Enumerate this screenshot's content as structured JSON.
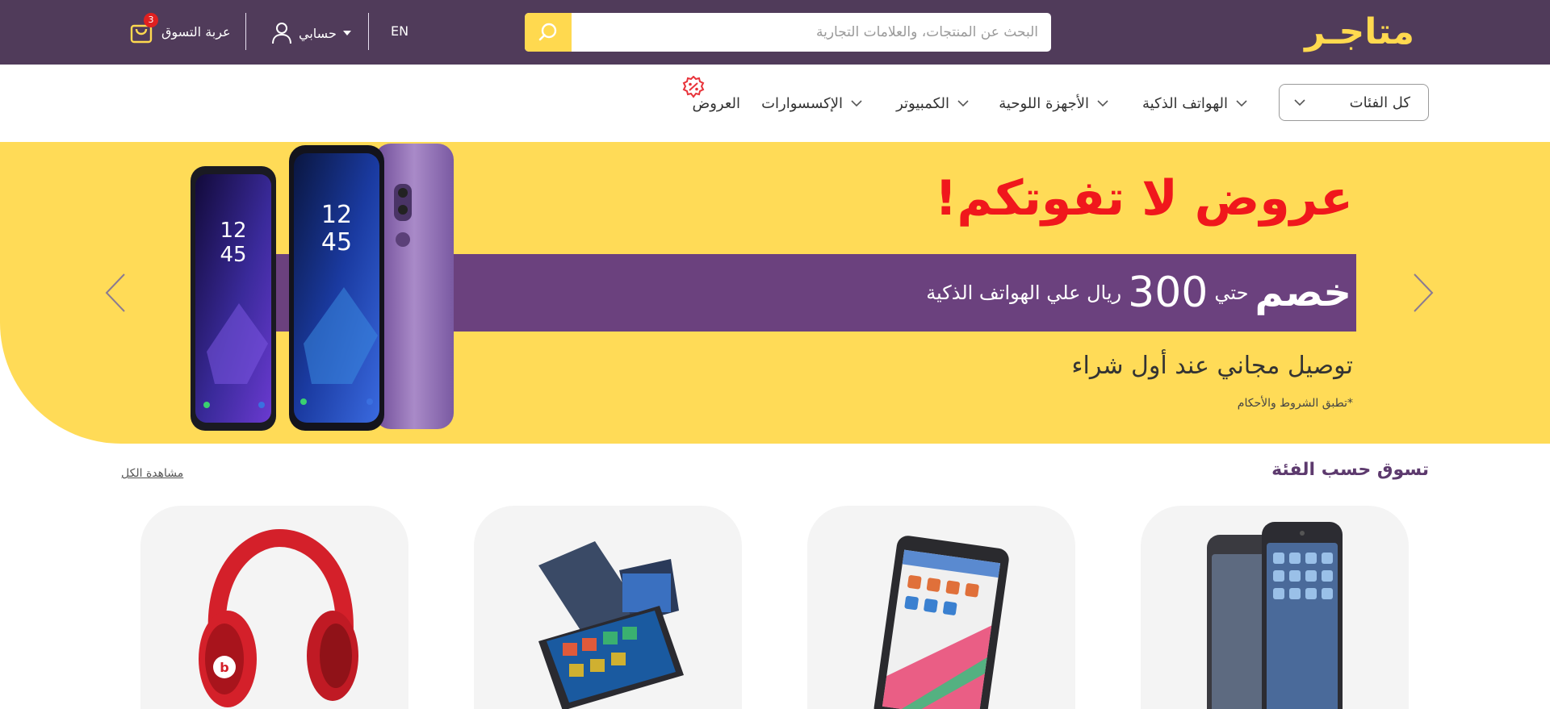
{
  "header": {
    "logo": "متاجـر",
    "search": {
      "placeholder": "البحث عن المنتجات، والعلامات التجارية"
    },
    "lang_label": "EN",
    "account_label": "حسابي",
    "cart_label": "عربة التسوق",
    "cart_count": "3",
    "colors": {
      "bar": "#503b5a",
      "accent": "#ffd94f",
      "badge": "#e02020"
    }
  },
  "nav": {
    "all_categories": "كل الفئات",
    "items": [
      {
        "label": "الهواتف الذكية",
        "has_dropdown": true
      },
      {
        "label": "الأجهزة اللوحية",
        "has_dropdown": true
      },
      {
        "label": "الكمبيوتر",
        "has_dropdown": true
      },
      {
        "label": "الإكسسوارات",
        "has_dropdown": true
      },
      {
        "label": "العروض",
        "has_dropdown": false,
        "badge_icon": "discount-badge-icon"
      }
    ]
  },
  "hero": {
    "title": "عروض لا تفوتكم!",
    "band_main": "خصم",
    "band_upto": "حتي",
    "band_amount": "300",
    "band_rest": "ريال علي الهواتف الذكية",
    "subtitle": "توصيل مجاني عند أول شراء",
    "terms": "*تطبق الشروط والأحكام",
    "colors": {
      "background": "#ffdb57",
      "title": "#f0171c",
      "band": "#6b417e"
    },
    "image": "smartphones-image"
  },
  "shop_by_category": {
    "title": "تسوق حسب الفئة",
    "view_all": "مشاهدة الكل",
    "cards": [
      {
        "image": "smartphone-image"
      },
      {
        "image": "tablet-image"
      },
      {
        "image": "laptop-image"
      },
      {
        "image": "headphones-image"
      }
    ]
  }
}
